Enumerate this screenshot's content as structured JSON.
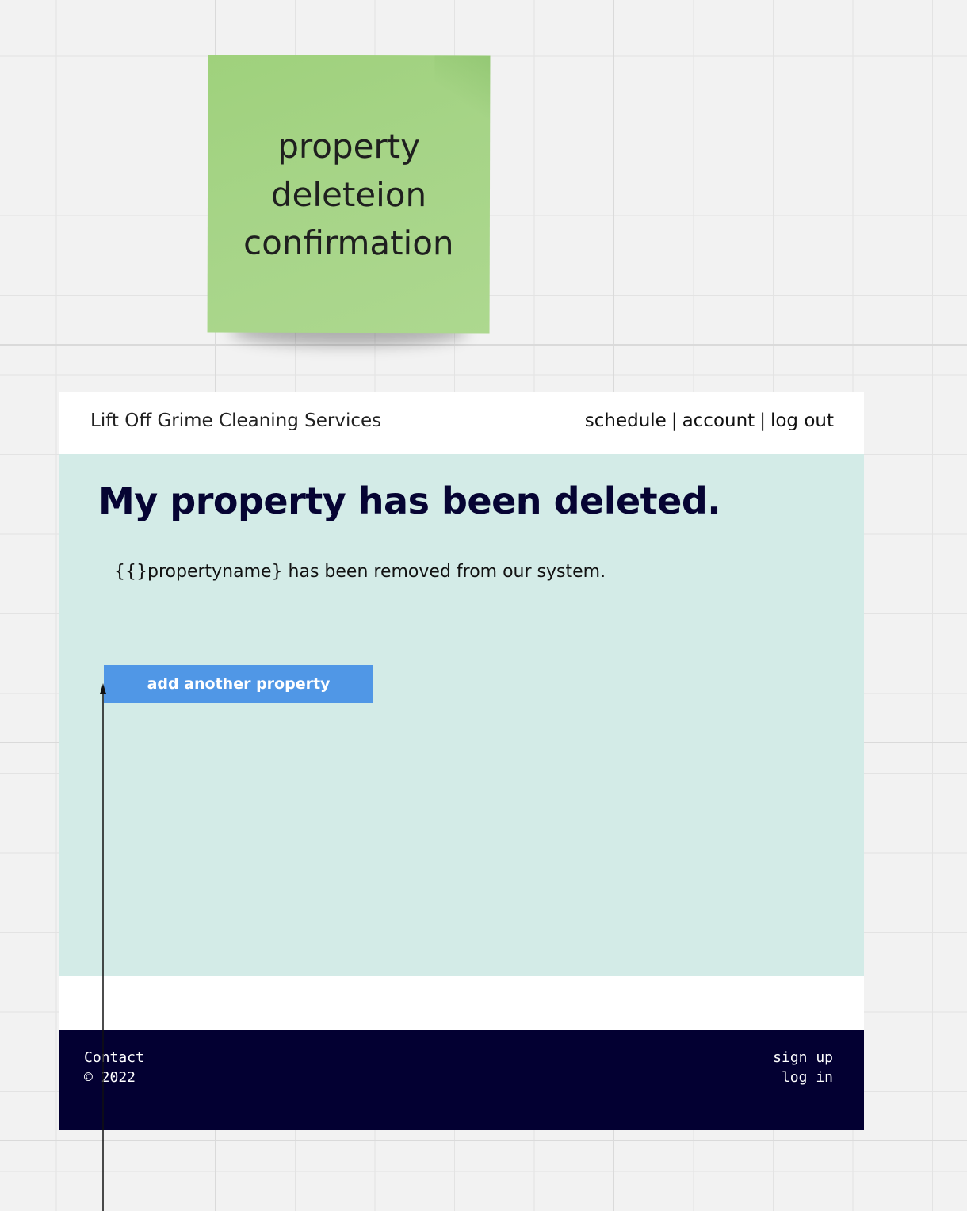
{
  "sticky_note": {
    "lines": [
      "property",
      "deleteion",
      "confirmation"
    ]
  },
  "header": {
    "brand": "Lift Off Grime Cleaning Services",
    "nav": {
      "schedule": "schedule",
      "account": "account",
      "logout": "log out",
      "separator": "|"
    }
  },
  "main": {
    "title": "My property has been deleted.",
    "message": "{{}propertyname} has been removed from our system.",
    "add_button_label": "add another property"
  },
  "footer": {
    "contact": "Contact",
    "copyright": "© 2022",
    "signup": "sign up",
    "login": "log in"
  },
  "colors": {
    "sticky": "#a6d487",
    "main_bg": "#d3ebe7",
    "title": "#060433",
    "button": "#5097e6",
    "footer_bg": "#030032"
  }
}
